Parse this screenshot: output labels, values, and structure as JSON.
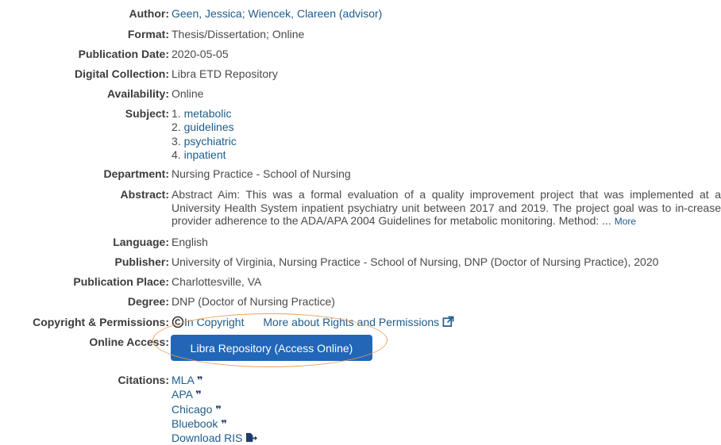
{
  "author": {
    "label": "Author:",
    "names": [
      "Geen, Jessica",
      "Wiencek, Clareen (advisor)"
    ],
    "separator": ";"
  },
  "format": {
    "label": "Format:",
    "value": "Thesis/Dissertation; Online"
  },
  "publication_date": {
    "label": "Publication Date:",
    "value": "2020-05-05"
  },
  "digital_collection": {
    "label": "Digital Collection:",
    "value": "Libra ETD Repository"
  },
  "availability": {
    "label": "Availability:",
    "value": "Online"
  },
  "subject": {
    "label": "Subject:",
    "items": [
      {
        "num": "1.",
        "text": "metabolic"
      },
      {
        "num": "2.",
        "text": "guidelines"
      },
      {
        "num": "3.",
        "text": "psychiatric"
      },
      {
        "num": "4.",
        "text": "inpatient"
      }
    ]
  },
  "department": {
    "label": "Department:",
    "value": "Nursing Practice - School of Nursing"
  },
  "abstract": {
    "label": "Abstract:",
    "text": "Abstract Aim: This was a formal evaluation of a quality improvement project that was implemented at a University Health System inpatient psychiatry unit between 2017 and 2019. The project goal was to in-crease provider adherence to the ADA/APA 2004 Guidelines for metabolic monitoring. Method: ...",
    "more_label": "More"
  },
  "language": {
    "label": "Language:",
    "value": "English"
  },
  "publisher": {
    "label": "Publisher:",
    "value": "University of Virginia, Nursing Practice - School of Nursing, DNP (Doctor of Nursing Practice), 2020"
  },
  "publication_place": {
    "label": "Publication Place:",
    "value": "Charlottesville, VA"
  },
  "degree": {
    "label": "Degree:",
    "value": "DNP (Doctor of Nursing Practice)"
  },
  "copyright": {
    "label": "Copyright & Permissions:",
    "status": "In Copyright",
    "more_link": "More about Rights and Permissions",
    "icon": "external-link-icon"
  },
  "online_access": {
    "label": "Online Access:",
    "button_label": "Libra Repository (Access Online)"
  },
  "citations": {
    "label": "Citations:",
    "items": [
      "MLA",
      "APA",
      "Chicago",
      "Bluebook"
    ],
    "download_label": "Download RIS",
    "quote_glyph": "❞"
  },
  "colors": {
    "link": "#1f5c8b",
    "button": "#2266b8",
    "highlight_oval": "#e9a25b"
  }
}
